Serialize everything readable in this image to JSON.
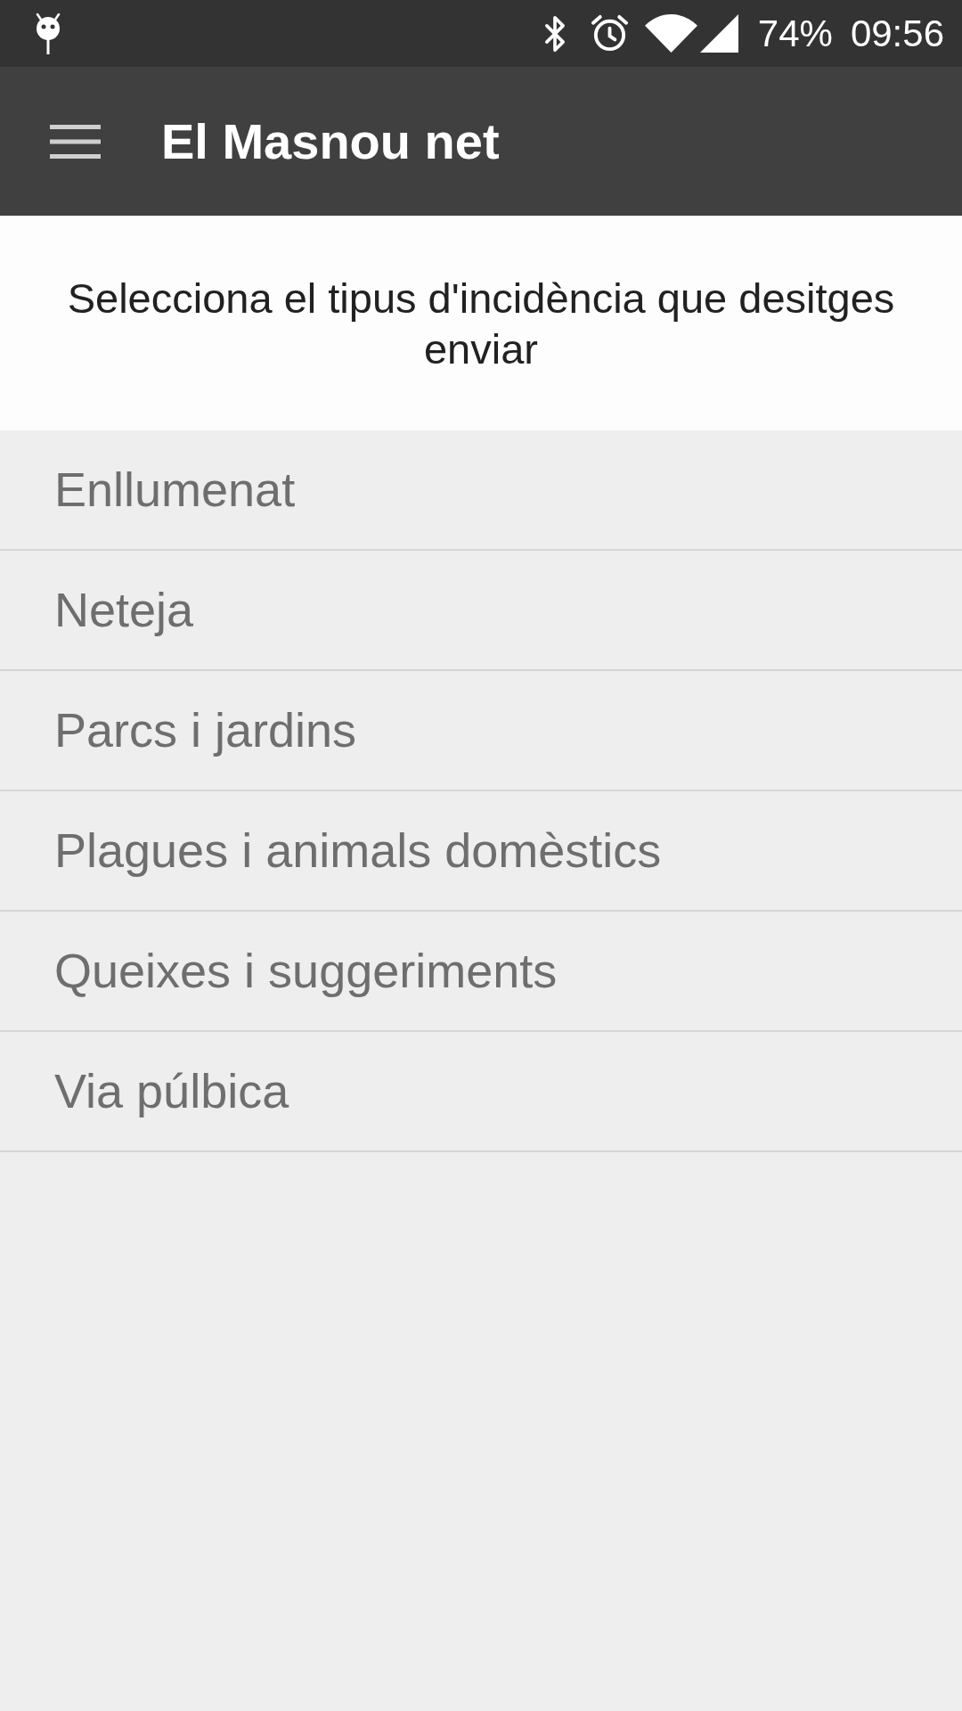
{
  "status_bar": {
    "battery": "74%",
    "time": "09:56"
  },
  "app_bar": {
    "title": "El Masnou net"
  },
  "prompt": "Selecciona el tipus d'incidència que desitges enviar",
  "incident_types": [
    "Enllumenat",
    "Neteja",
    "Parcs i jardins",
    "Plagues i animals domèstics",
    "Queixes i suggeriments",
    "Via púlbica"
  ]
}
